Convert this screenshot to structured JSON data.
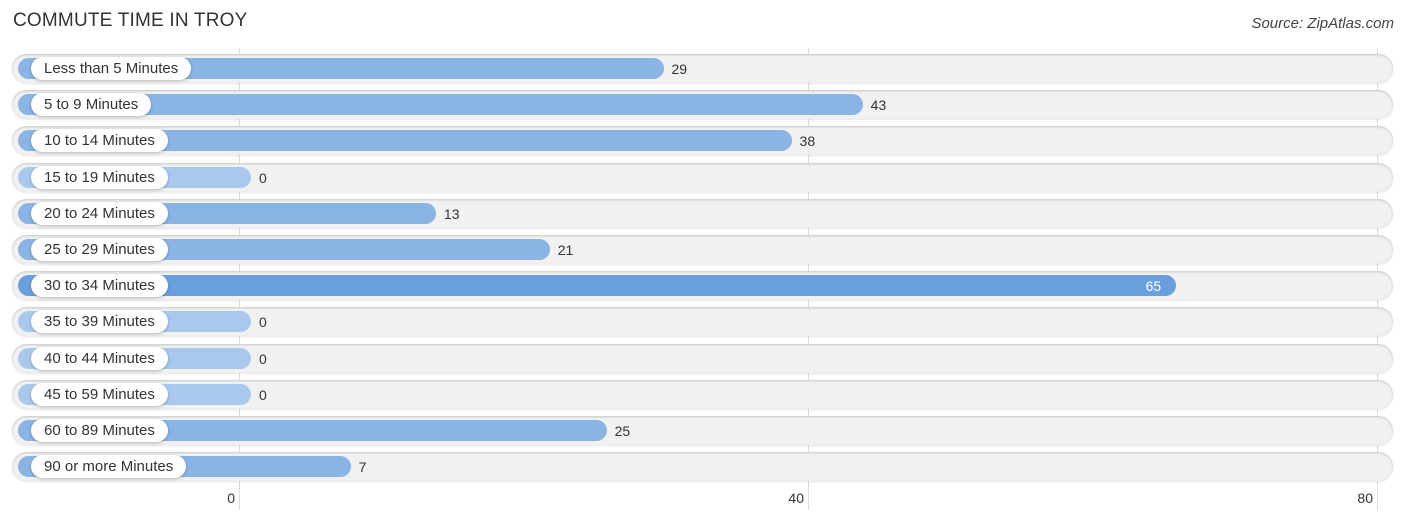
{
  "chart_data": {
    "type": "bar",
    "orientation": "horizontal",
    "title": "COMMUTE TIME IN TROY",
    "source": "Source: ZipAtlas.com",
    "categories": [
      "Less than 5 Minutes",
      "5 to 9 Minutes",
      "10 to 14 Minutes",
      "15 to 19 Minutes",
      "20 to 24 Minutes",
      "25 to 29 Minutes",
      "30 to 34 Minutes",
      "35 to 39 Minutes",
      "40 to 44 Minutes",
      "45 to 59 Minutes",
      "60 to 89 Minutes",
      "90 or more Minutes"
    ],
    "values": [
      29,
      43,
      38,
      0,
      13,
      21,
      65,
      0,
      0,
      0,
      25,
      7
    ],
    "xlim": [
      0,
      80
    ],
    "xticks": [
      "0",
      "40",
      "80"
    ],
    "xlabel": "",
    "ylabel": "",
    "grid": true,
    "colors": {
      "bar": "#8ab4e3",
      "highlight": "#6a9fde",
      "zero": "#aac8ec"
    }
  }
}
